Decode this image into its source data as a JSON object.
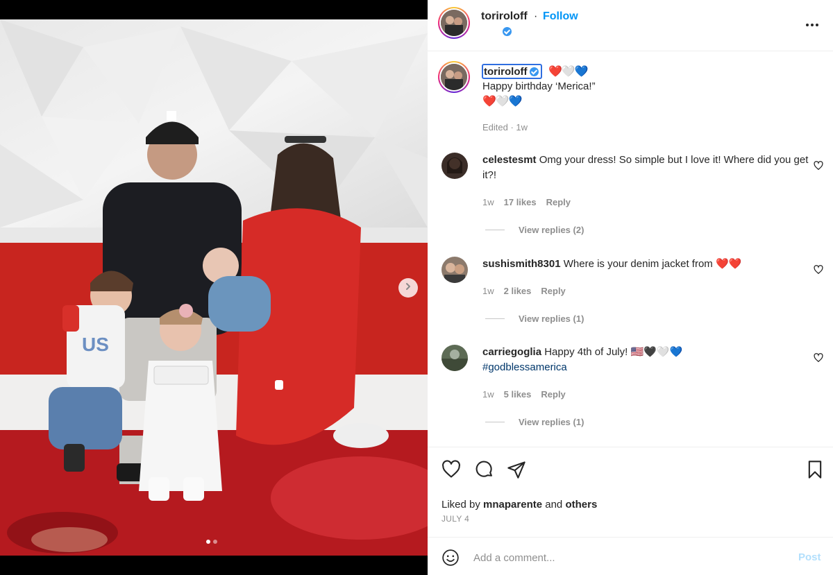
{
  "post": {
    "username": "toriroloff",
    "follow_label": "Follow",
    "separator": "·",
    "caption_line1": "Happy birthday ‘Merica!”",
    "caption_hearts1": "❤️🤍💙",
    "caption_hearts2": "❤️🤍💙",
    "caption_meta": "Edited · 1w"
  },
  "comments": [
    {
      "username": "celestesmt",
      "text": "Omg your dress! So simple but I love it! Where did you get it?!",
      "time": "1w",
      "likes": "17 likes",
      "reply_label": "Reply",
      "view_replies": "View replies (2)"
    },
    {
      "username": "sushismith8301",
      "text": "Where is your denim jacket from",
      "hearts": "❤️❤️",
      "time": "1w",
      "likes": "2 likes",
      "reply_label": "Reply",
      "view_replies": "View replies (1)"
    },
    {
      "username": "carriegoglia",
      "text": "Happy 4th of July!",
      "emoji": "🇺🇸🖤🤍💙",
      "hashtag": "#godblessamerica",
      "time": "1w",
      "likes": "5 likes",
      "reply_label": "Reply",
      "view_replies": "View replies (1)"
    }
  ],
  "likes": {
    "prefix": "Liked by",
    "user": "mnaparente",
    "joiner": "and",
    "others": "others"
  },
  "date": "JULY 4",
  "composer": {
    "placeholder": "Add a comment...",
    "post_label": "Post"
  },
  "carousel": {
    "slide_count": 2,
    "current_slide": 1
  },
  "colors": {
    "link_blue": "#0095f6",
    "post_disabled": "#b2dffc",
    "muted": "#8e8e8e",
    "text": "#262626"
  }
}
